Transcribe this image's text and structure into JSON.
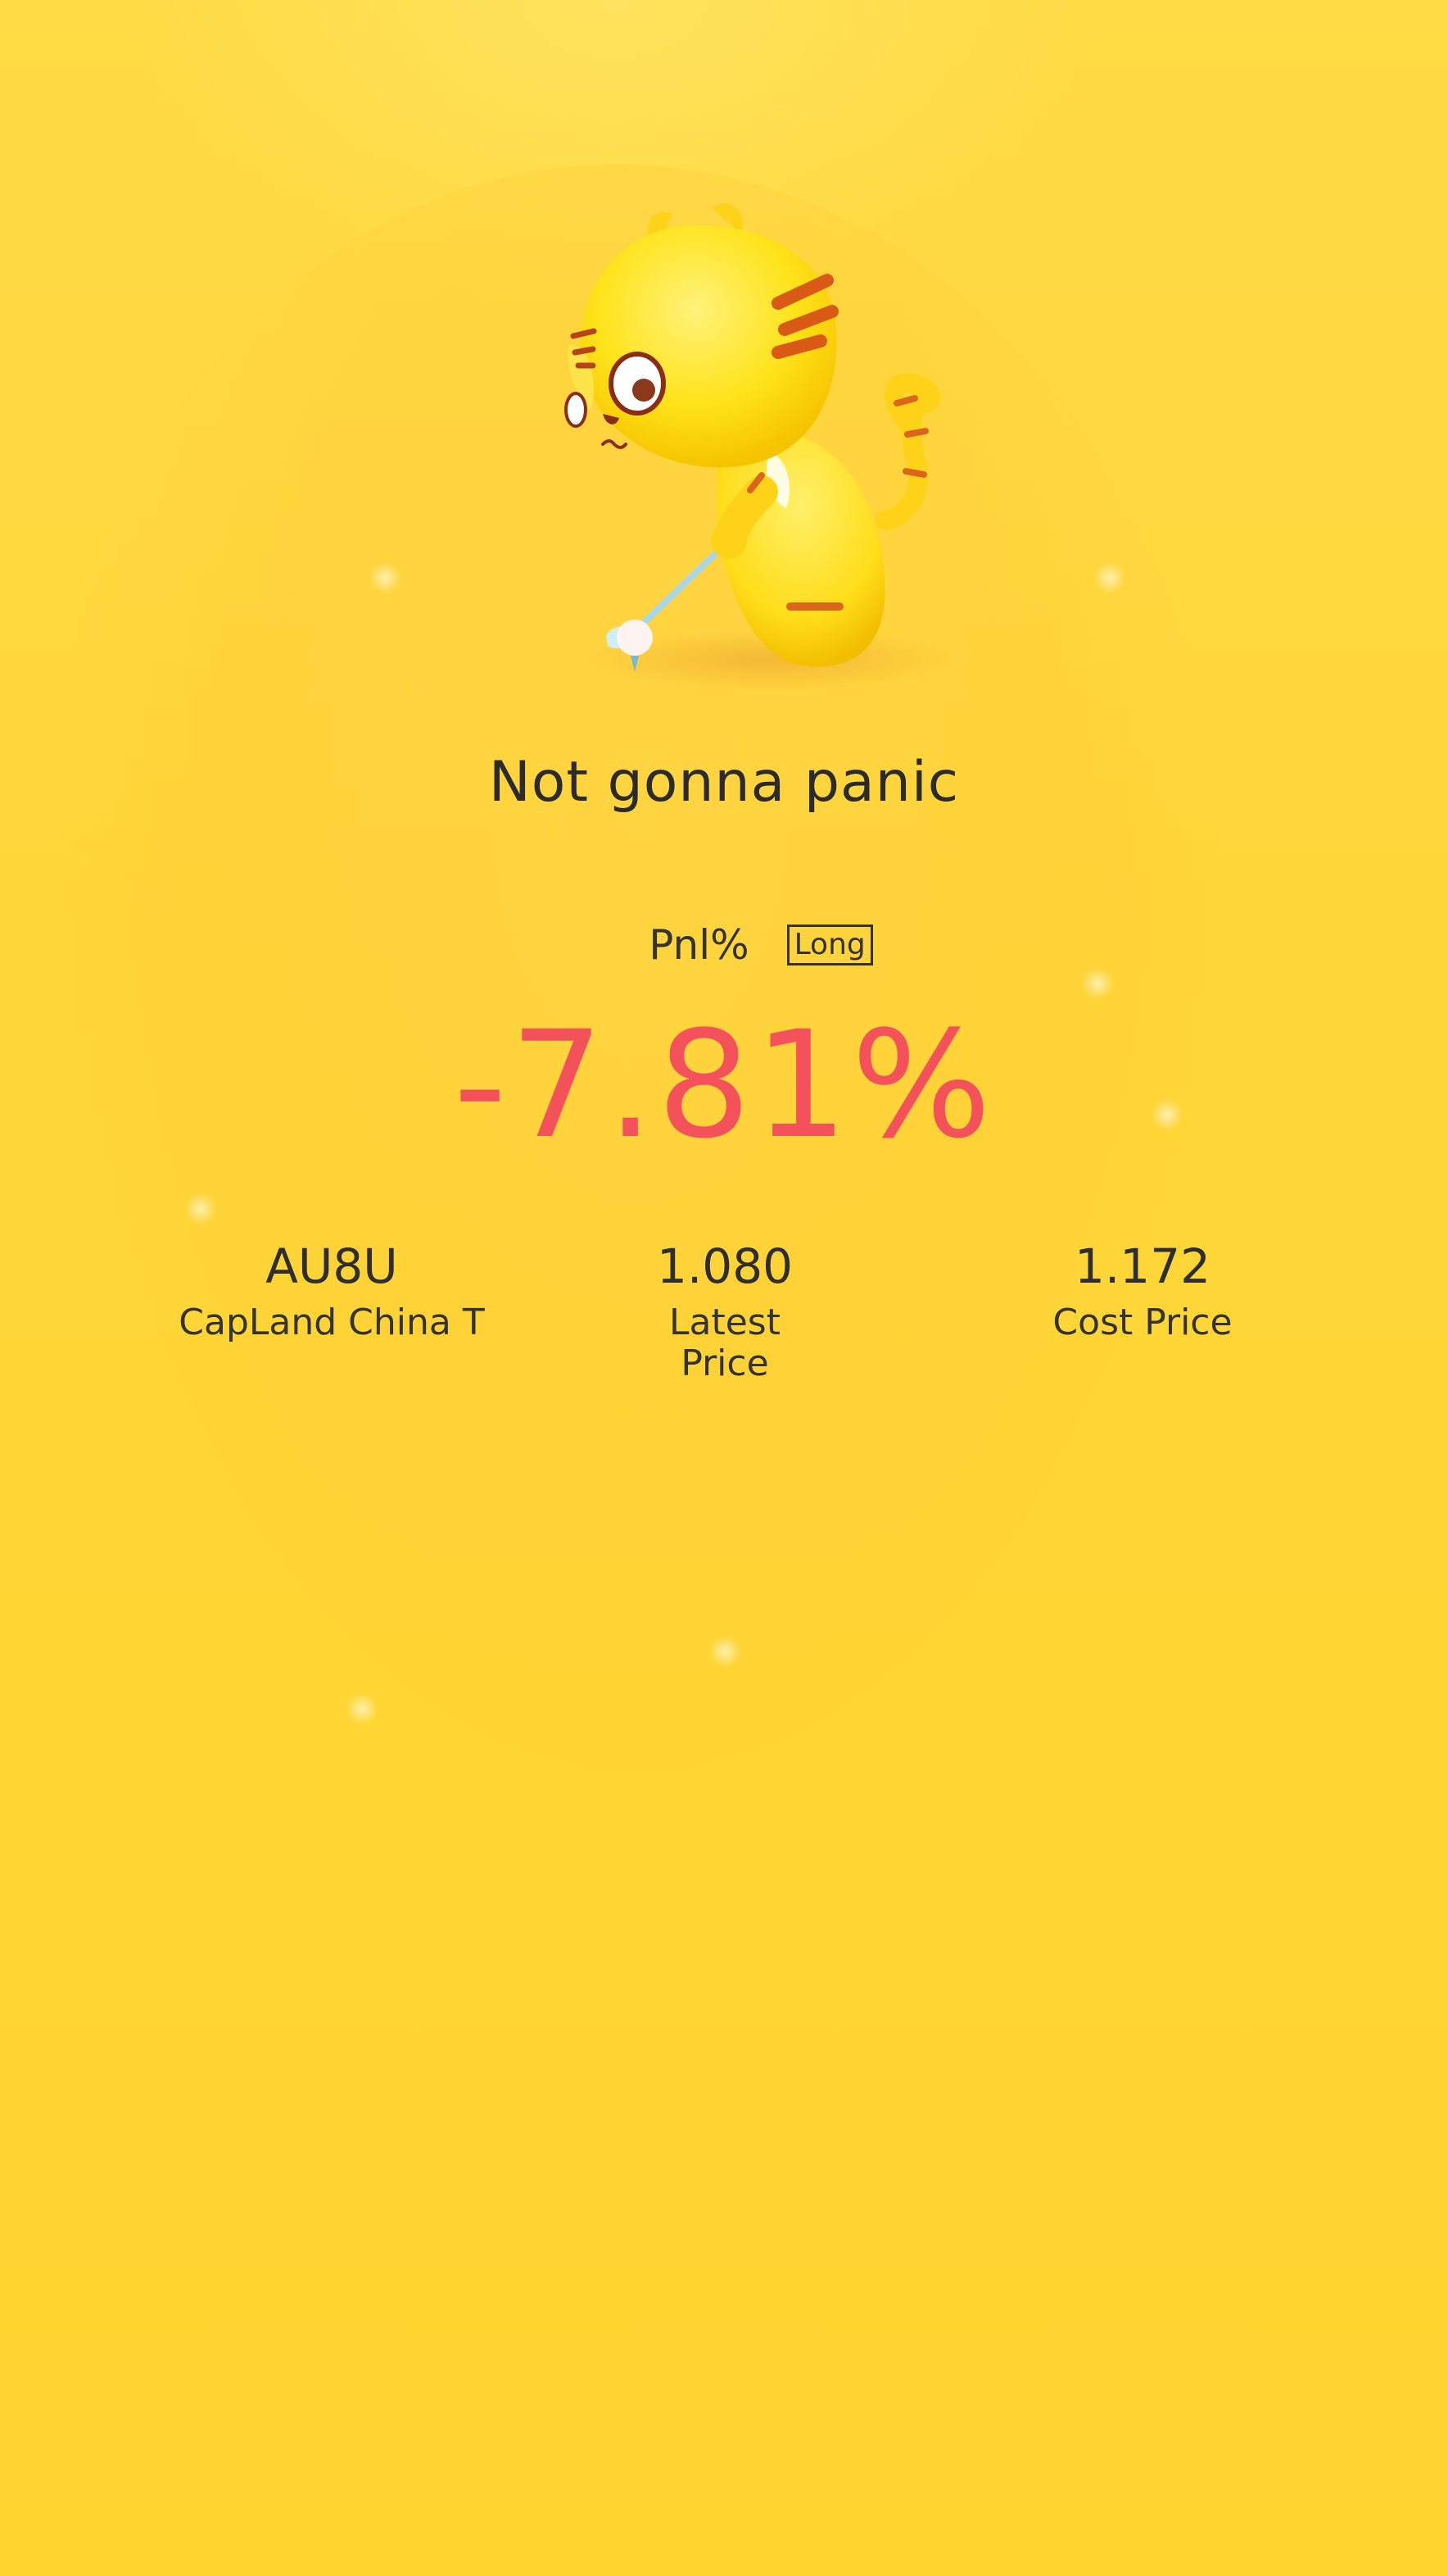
{
  "headline": "Not gonna panic",
  "pnl": {
    "label": "Pnl%",
    "direction": "Long",
    "value": "-7.81%"
  },
  "stats": {
    "symbol": {
      "value": "AU8U",
      "label": "CapLand China T"
    },
    "latest_price": {
      "value": "1.080",
      "label_line1": "Latest",
      "label_line2": "Price"
    },
    "cost_price": {
      "value": "1.172",
      "label": "Cost Price"
    }
  },
  "colors": {
    "background": "#ffd63a",
    "loss_red": "#f4525a",
    "text": "#333333"
  },
  "icons": [
    "tiger-golfer-mascot-icon"
  ]
}
